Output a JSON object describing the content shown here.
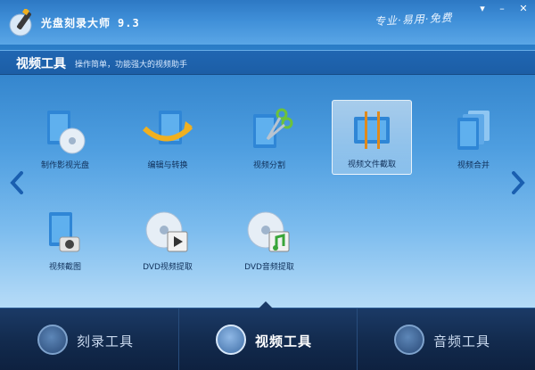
{
  "window": {
    "title": "光盘刻录大师",
    "version": "9.3",
    "slogan": "专业·易用·免费"
  },
  "winbtns": {
    "menu": "▾",
    "minimize": "–",
    "close": "✕"
  },
  "section": {
    "title": "视频工具",
    "subtitle": "操作简单，功能强大的视频助手"
  },
  "tools": [
    {
      "label": "制作影视光盘",
      "icon": "film-disc-icon"
    },
    {
      "label": "编辑与转换",
      "icon": "film-arrow-icon"
    },
    {
      "label": "视频分割",
      "icon": "film-scissors-icon"
    },
    {
      "label": "视频文件截取",
      "icon": "film-clip-icon",
      "selected": true
    },
    {
      "label": "视频合并",
      "icon": "film-stack-icon"
    },
    {
      "label": "视频截图",
      "icon": "film-camera-icon"
    },
    {
      "label": "DVD视频提取",
      "icon": "dvd-film-icon"
    },
    {
      "label": "DVD音频提取",
      "icon": "dvd-music-icon"
    }
  ],
  "nav": [
    {
      "label": "刻录工具",
      "icon": "disc-icon"
    },
    {
      "label": "视频工具",
      "icon": "video-icon",
      "active": true
    },
    {
      "label": "音频工具",
      "icon": "music-note-icon"
    }
  ],
  "colors": {
    "accent": "#2a7cc6",
    "navbar": "#122a4d",
    "film": "#2f86d6"
  }
}
